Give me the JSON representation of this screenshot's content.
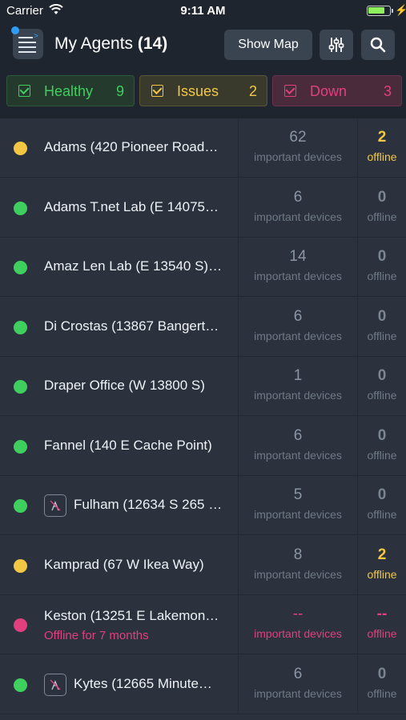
{
  "status_bar": {
    "carrier": "Carrier",
    "time": "9:11 AM"
  },
  "header": {
    "title": "My Agents",
    "count": "(14)",
    "show_map_label": "Show Map"
  },
  "filters": [
    {
      "label": "Healthy",
      "count": "9"
    },
    {
      "label": "Issues",
      "count": "2"
    },
    {
      "label": "Down",
      "count": "3"
    }
  ],
  "agents": [
    {
      "name": "Adams (420 Pioneer Road…",
      "status": "issue",
      "has_icon": false,
      "important_devices": "62",
      "important_label": "important devices",
      "offline": "2",
      "offline_label": "offline"
    },
    {
      "name": "Adams T.net Lab (E 14075…",
      "status": "healthy",
      "has_icon": false,
      "important_devices": "6",
      "important_label": "important devices",
      "offline": "0",
      "offline_label": "offline"
    },
    {
      "name": "Amaz Len Lab (E 13540 S)…",
      "status": "healthy",
      "has_icon": false,
      "important_devices": "14",
      "important_label": "important devices",
      "offline": "0",
      "offline_label": "offline"
    },
    {
      "name": "Di Crostas (13867 Bangert…",
      "status": "healthy",
      "has_icon": false,
      "important_devices": "6",
      "important_label": "important devices",
      "offline": "0",
      "offline_label": "offline"
    },
    {
      "name": "Draper Office (W 13800 S)",
      "status": "healthy",
      "has_icon": false,
      "important_devices": "1",
      "important_label": "important devices",
      "offline": "0",
      "offline_label": "offline"
    },
    {
      "name": "Fannel (140 E Cache Point)",
      "status": "healthy",
      "has_icon": false,
      "important_devices": "6",
      "important_label": "important devices",
      "offline": "0",
      "offline_label": "offline"
    },
    {
      "name": "Fulham (12634 S 265 …",
      "status": "healthy",
      "has_icon": true,
      "important_devices": "5",
      "important_label": "important devices",
      "offline": "0",
      "offline_label": "offline"
    },
    {
      "name": "Kamprad (67 W Ikea Way)",
      "status": "issue",
      "has_icon": false,
      "important_devices": "8",
      "important_label": "important devices",
      "offline": "2",
      "offline_label": "offline"
    },
    {
      "name": "Keston (13251 E Lakemon…",
      "status": "down",
      "has_icon": false,
      "subline": "Offline for 7 months",
      "important_devices": "--",
      "important_label": "important devices",
      "offline": "--",
      "offline_label": "offline"
    },
    {
      "name": "Kytes (12665 Minute…",
      "status": "healthy",
      "has_icon": true,
      "important_devices": "6",
      "important_label": "important devices",
      "offline": "0",
      "offline_label": "offline"
    }
  ],
  "colors": {
    "healthy": "#3fcf5e",
    "issue": "#f3c743",
    "down": "#e23f7f"
  },
  "icons": {
    "wifi": "wifi-icon",
    "battery": "battery-icon",
    "menu": "menu-icon",
    "filter": "sliders-icon",
    "search": "search-icon",
    "agent": "agent-icon"
  }
}
